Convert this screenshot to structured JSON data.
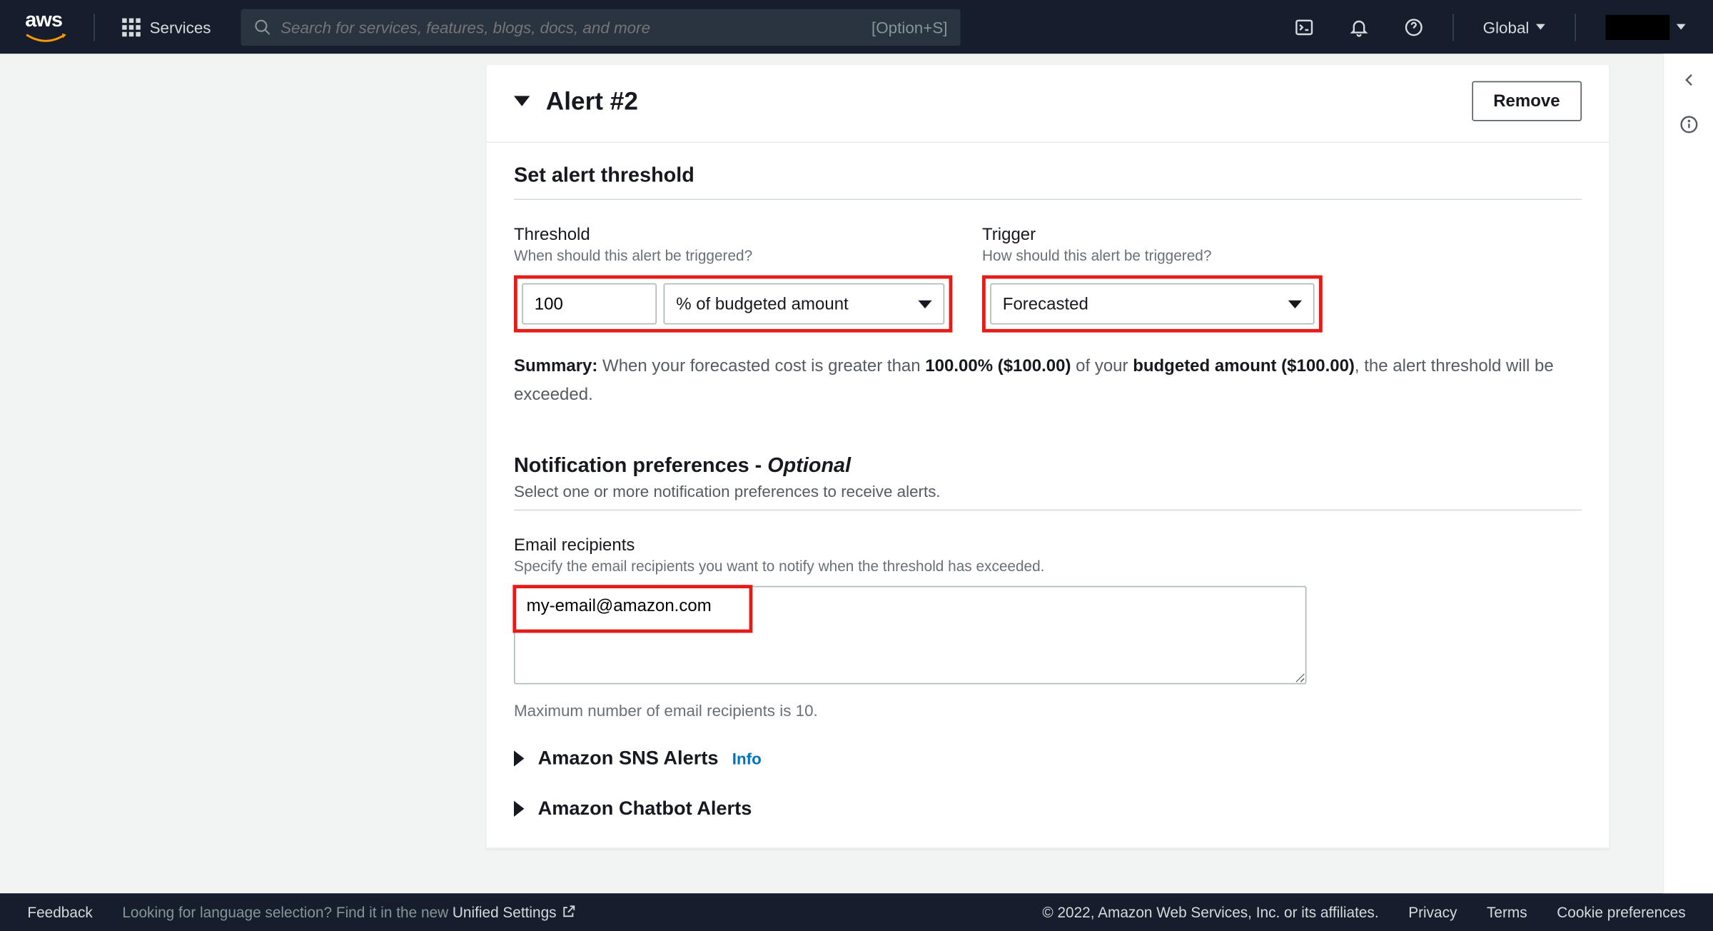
{
  "nav": {
    "services_label": "Services",
    "search_placeholder": "Search for services, features, blogs, docs, and more",
    "search_shortcut": "[Option+S]",
    "region": "Global"
  },
  "card": {
    "title": "Alert #2",
    "remove_label": "Remove"
  },
  "threshold_section": {
    "title": "Set alert threshold",
    "threshold_label": "Threshold",
    "threshold_hint": "When should this alert be triggered?",
    "threshold_value": "100",
    "threshold_unit": "% of budgeted amount",
    "trigger_label": "Trigger",
    "trigger_hint": "How should this alert be triggered?",
    "trigger_value": "Forecasted",
    "summary_label": "Summary:",
    "summary_cost_text": "When your forecasted cost is greater than",
    "summary_percent": "100.00% ($100.00)",
    "summary_of": "of your",
    "summary_budget": "budgeted amount ($100.00)",
    "summary_tail": ", the alert threshold will be exceeded."
  },
  "notif_section": {
    "title_main": "Notification preferences - ",
    "title_opt": "Optional",
    "subtitle": "Select one or more notification preferences to receive alerts.",
    "email_label": "Email recipients",
    "email_hint": "Specify the email recipients you want to notify when the threshold has exceeded.",
    "email_value": "my-email@amazon.com",
    "email_max": "Maximum number of email recipients is 10.",
    "sns_label": "Amazon SNS Alerts",
    "info_label": "Info",
    "chatbot_label": "Amazon Chatbot Alerts"
  },
  "footer": {
    "feedback": "Feedback",
    "lang_prefix": "Looking for language selection? Find it in the new ",
    "lang_link": "Unified Settings",
    "copyright": "© 2022, Amazon Web Services, Inc. or its affiliates.",
    "privacy": "Privacy",
    "terms": "Terms",
    "cookie": "Cookie preferences"
  }
}
